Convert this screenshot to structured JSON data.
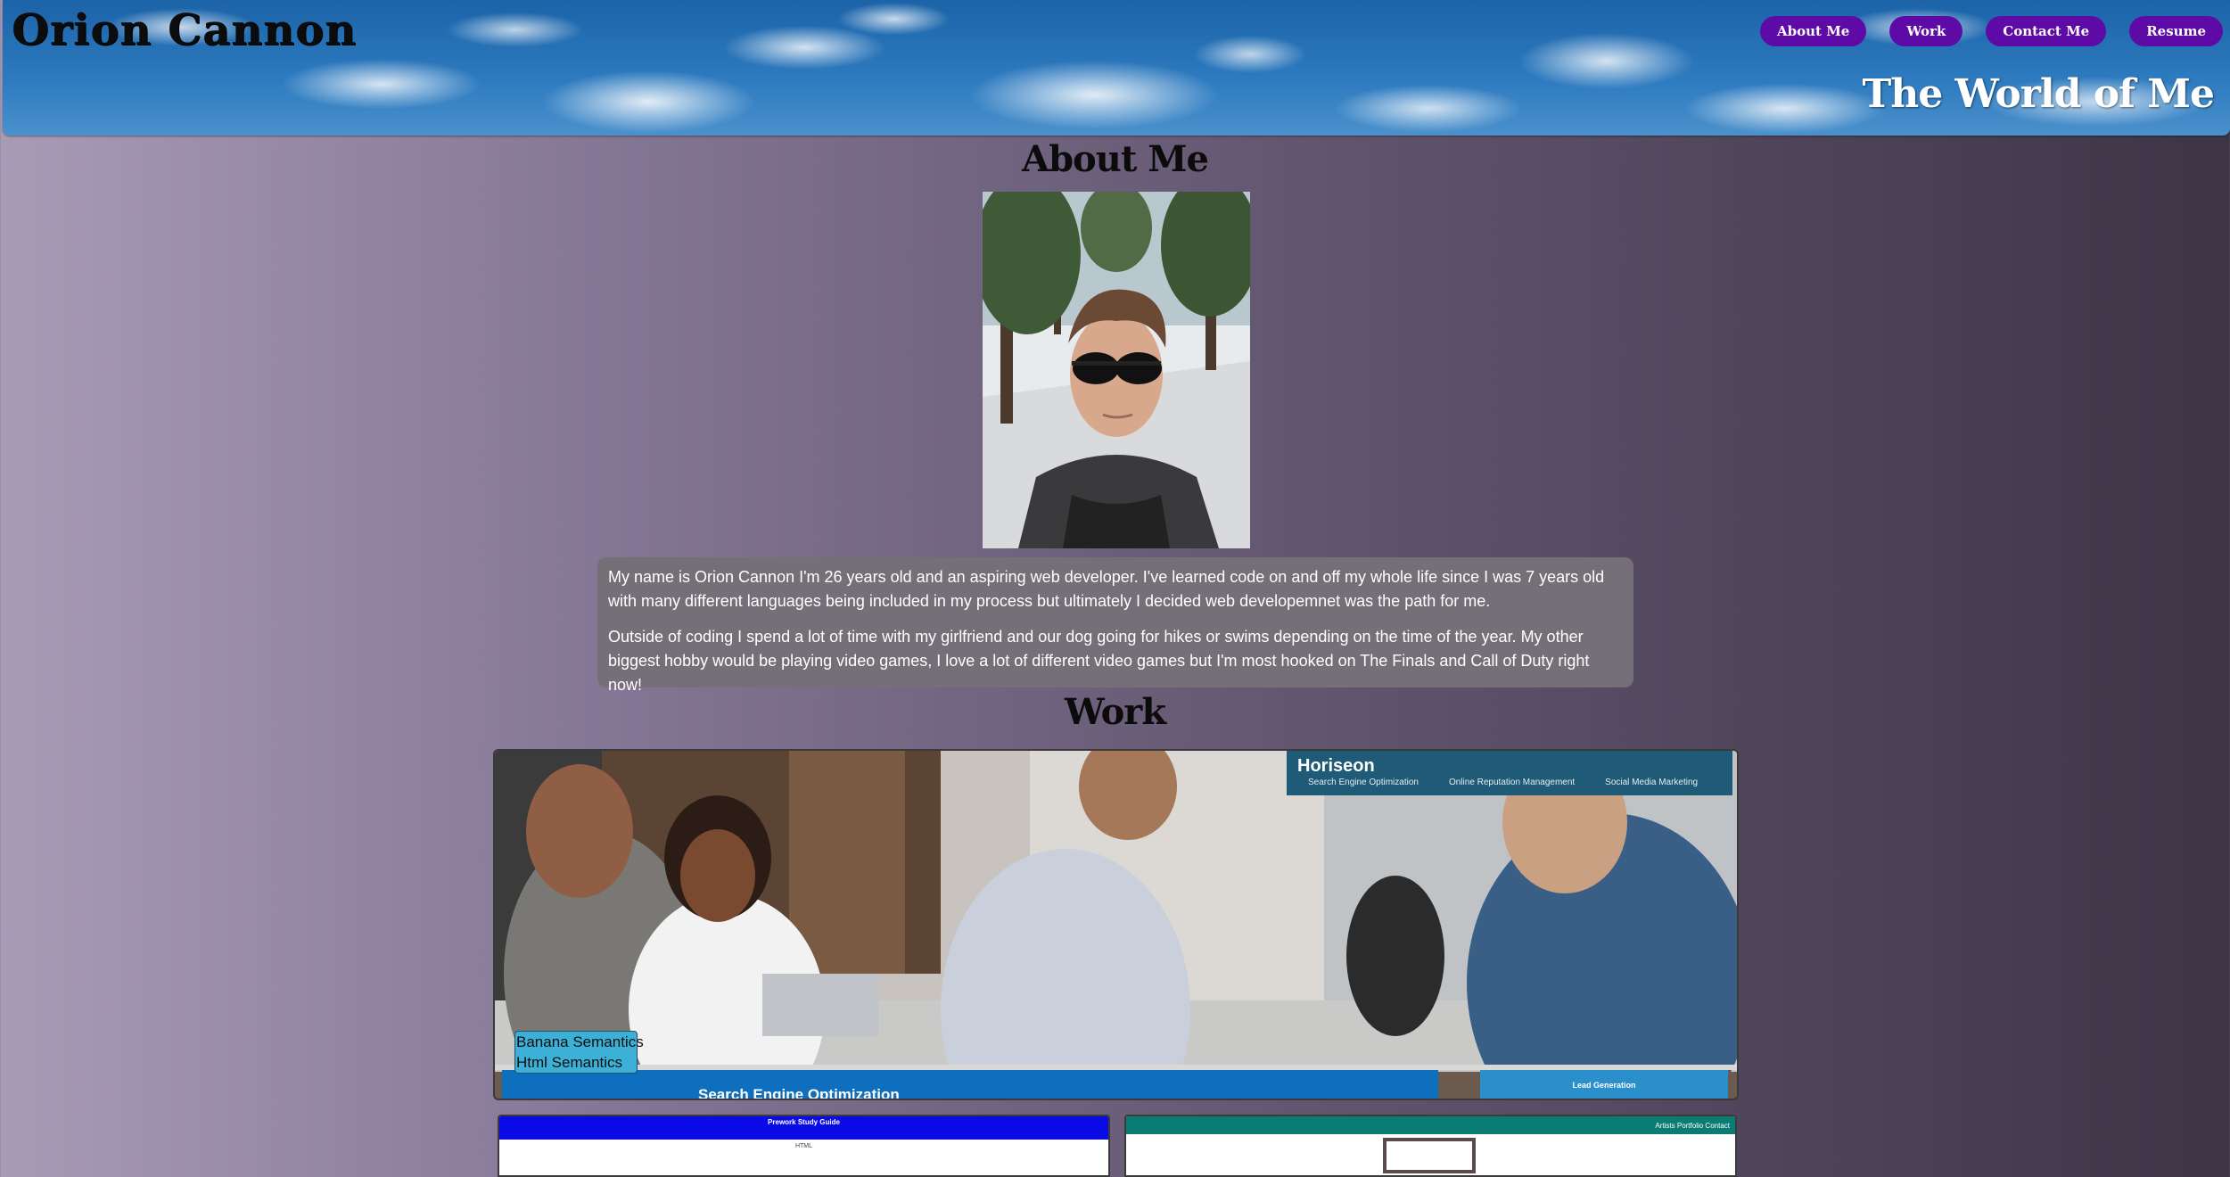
{
  "header": {
    "brand": "Orion Cannon",
    "tagline": "The World of Me",
    "nav": [
      "About Me",
      "Work",
      "Contact Me",
      "Resume"
    ]
  },
  "about": {
    "title": "About Me",
    "bio": [
      "My name is Orion Cannon I'm 26 years old and an aspiring web developer. I've learned code on and off my whole life since I was 7 years old with many different languages being included in my process but ultimately I decided web developemnet was the path for me.",
      "Outside of coding I spend a lot of time with my girlfriend and our dog going for hikes or swims depending on the time of the year. My other biggest hobby would be playing video games, I love a lot of different video games but I'm most hooked on The Finals and Call of Duty right now!"
    ]
  },
  "work": {
    "title": "Work",
    "featured": {
      "tags": [
        "Banana Semantics",
        "Html Semantics"
      ],
      "screenshot": {
        "logo": "Horiseon",
        "links": [
          "Search Engine Optimization",
          "Online Reputation Management",
          "Social Media Marketing"
        ],
        "banner": "Search Engine Optimization",
        "side_label": "Lead Generation"
      }
    },
    "thumbs": [
      {
        "title": "Prework Study Guide",
        "sub": "HTML"
      },
      {
        "links": "Artists Portfolio Contact"
      }
    ]
  },
  "colors": {
    "nav_button": "#5d0aa6",
    "bio_bg": "#757078",
    "tag_bg": "#3cb0d6"
  }
}
